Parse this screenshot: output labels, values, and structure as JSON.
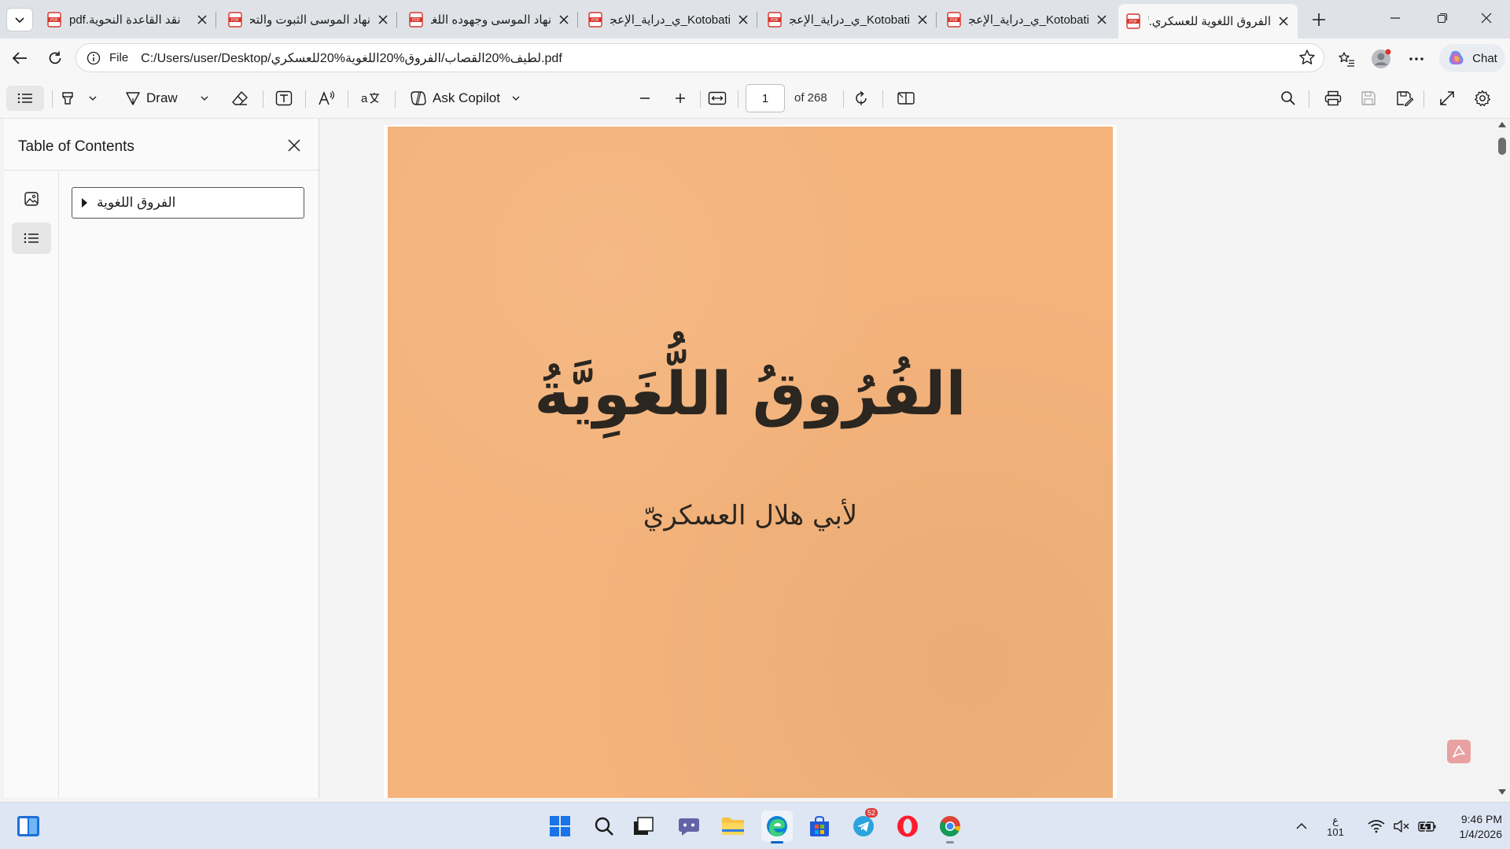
{
  "tabs": [
    {
      "label": "نقد القاعدة النحوية.pdf"
    },
    {
      "label": "نهاد الموسى الثبوت والتحو"
    },
    {
      "label": "نهاد الموسى وجهوده اللغو"
    },
    {
      "label": "Kotobati_ي_دراية_الإعجاز"
    },
    {
      "label": "Kotobati_ي_دراية_الإعجاز"
    },
    {
      "label": "Kotobati_ي_دراية_الإعجاز"
    },
    {
      "label": "الفروق اللغوية للعسكري.f"
    }
  ],
  "address": {
    "scheme": "File",
    "url": "C:/Users/user/Desktop/لطيف%20القصاب/الفروق%20اللغوية%20للعسكري.pdf"
  },
  "chat_label": "Chat",
  "toolbar": {
    "draw_label": "Draw",
    "copilot_label": "Ask Copilot",
    "page_number": "1",
    "page_count": "of 268"
  },
  "sidebar": {
    "title": "Table of Contents",
    "toc_items": [
      {
        "label": "الفروق اللغوية"
      }
    ]
  },
  "document": {
    "cover_title": "الفُرُوقُ اللُّغَوِيَّةُ",
    "cover_author": "لأبي هلال العسكريّ",
    "page_color": "#f4b37b"
  },
  "taskbar": {
    "telegram_badge": "52",
    "tray_lang_top": "ع",
    "tray_lang_bottom": "101",
    "time": "9:46 PM",
    "date": "1/4/2026"
  },
  "colors": {
    "accent": "#0067c0",
    "tab_strip": "#dfe3e8",
    "pdf_red": "#d9342b"
  }
}
